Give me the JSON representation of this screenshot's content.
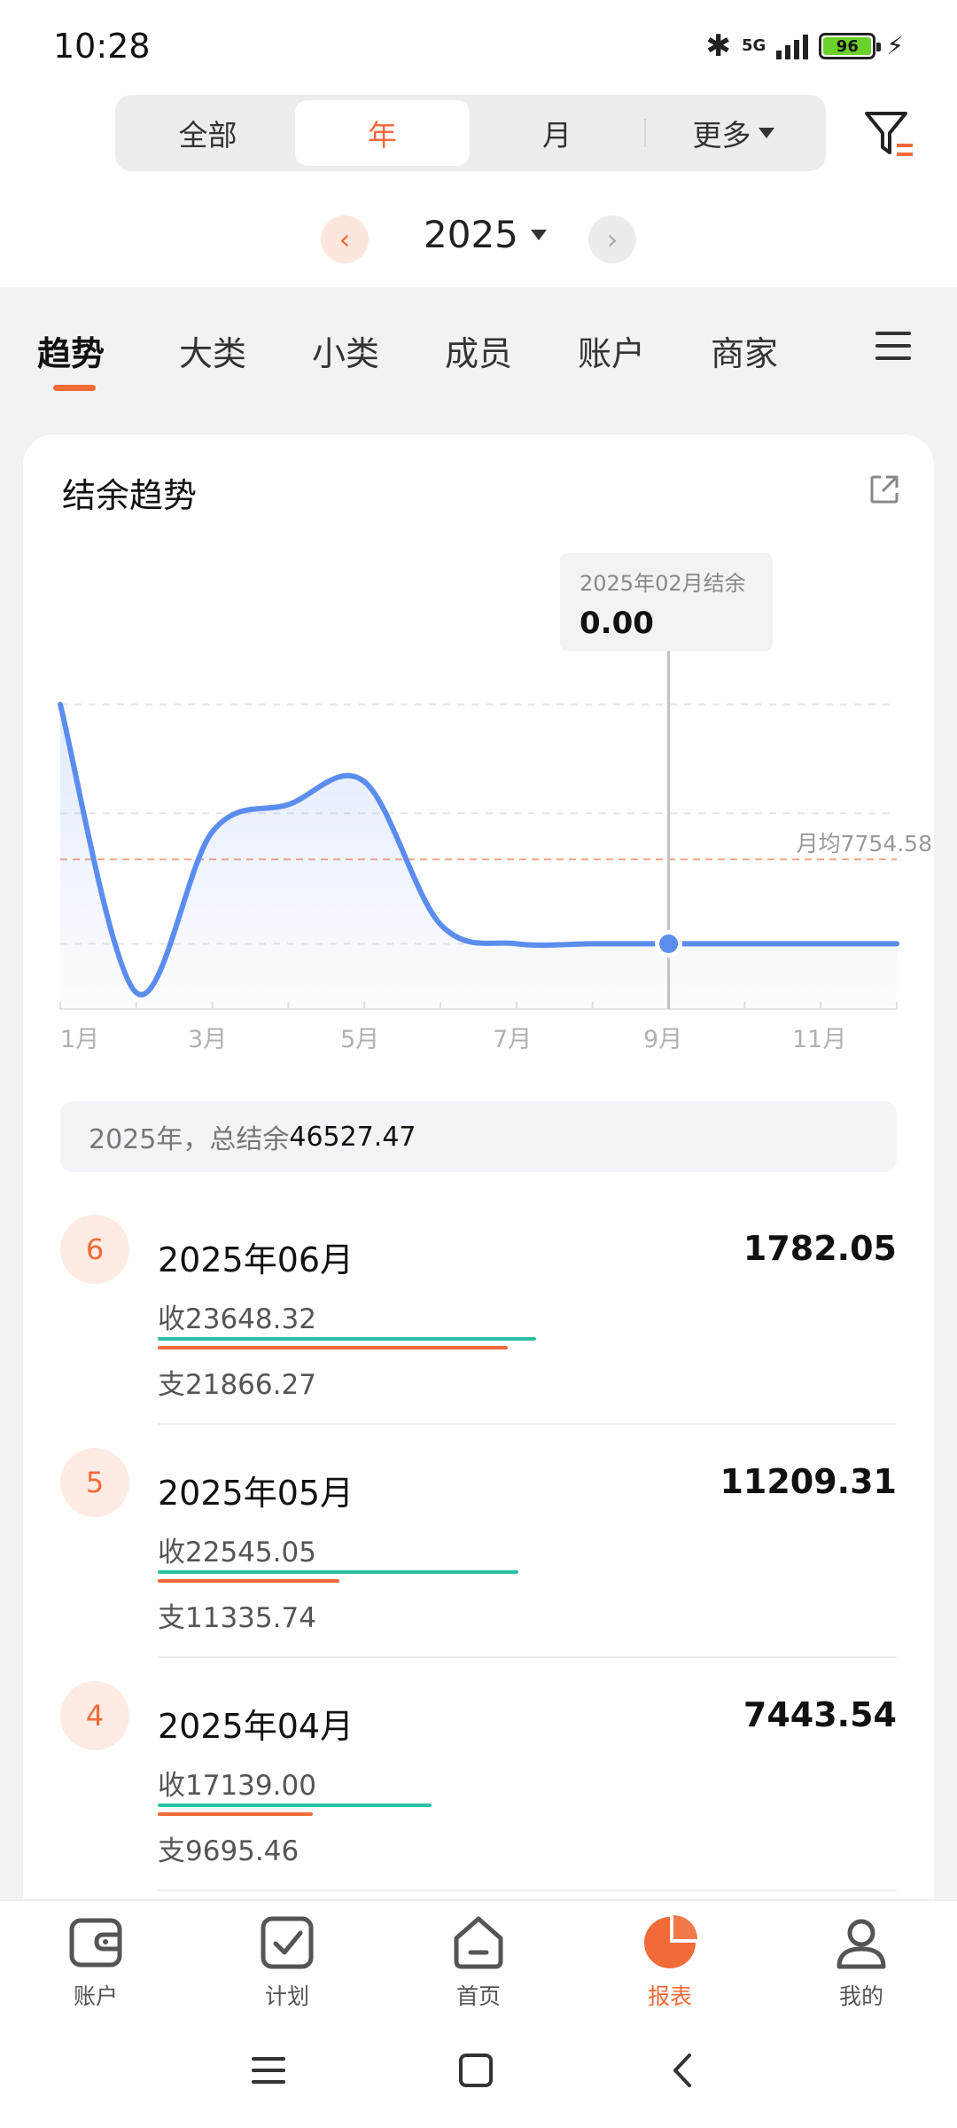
{
  "status_bar": {
    "time": "10:28",
    "network": "5G",
    "battery": "96"
  },
  "filter_tabs": {
    "items": [
      "全部",
      "年",
      "月"
    ],
    "active": "年",
    "more": "更多"
  },
  "year_selector": {
    "year": "2025"
  },
  "report_tabs": {
    "items": [
      "趋势",
      "大类",
      "小类",
      "成员",
      "账户",
      "商家"
    ],
    "active": "趋势"
  },
  "card": {
    "title": "结余趋势"
  },
  "chart_data": {
    "type": "line",
    "title": "结余趋势",
    "x_tick_labels": [
      "1月",
      "3月",
      "5月",
      "7月",
      "9月",
      "11月"
    ],
    "categories": [
      "1月",
      "2月",
      "3月",
      "4月",
      "5月",
      "6月",
      "7月",
      "8月",
      "9月",
      "10月",
      "11月",
      "12月"
    ],
    "series": [
      {
        "values": [
          22000,
          -4500,
          10300,
          12800,
          14900,
          1782.05,
          0,
          0,
          0,
          0,
          0,
          0
        ]
      }
    ],
    "average_label": "月均7754.58",
    "average_value": 7754.58,
    "tooltip": {
      "title": "2025年02月结余",
      "value": "0.00",
      "highlight_index": 8
    },
    "ylim": [
      -6000,
      24000
    ],
    "grid": true,
    "color": "#5b8def"
  },
  "summary": {
    "prefix": "2025年，总结余",
    "value": "46527.47"
  },
  "months": [
    {
      "badge": "6",
      "title": "2025年06月",
      "amount": "1782.05",
      "income": "收23648.32",
      "expense": "支21866.27",
      "income_value": 23648.32,
      "expense_value": 21866.27
    },
    {
      "badge": "5",
      "title": "2025年05月",
      "amount": "11209.31",
      "income": "收22545.05",
      "expense": "支11335.74",
      "income_value": 22545.05,
      "expense_value": 11335.74
    },
    {
      "badge": "4",
      "title": "2025年04月",
      "amount": "7443.54",
      "income": "收17139.00",
      "expense": "支9695.46",
      "income_value": 17139.0,
      "expense_value": 9695.46
    }
  ],
  "bottom_nav": {
    "items": [
      "账户",
      "计划",
      "首页",
      "报表",
      "我的"
    ],
    "active": "报表"
  },
  "colors": {
    "accent": "#f26a37",
    "income": "#2bbfa4",
    "line": "#5b8def"
  }
}
